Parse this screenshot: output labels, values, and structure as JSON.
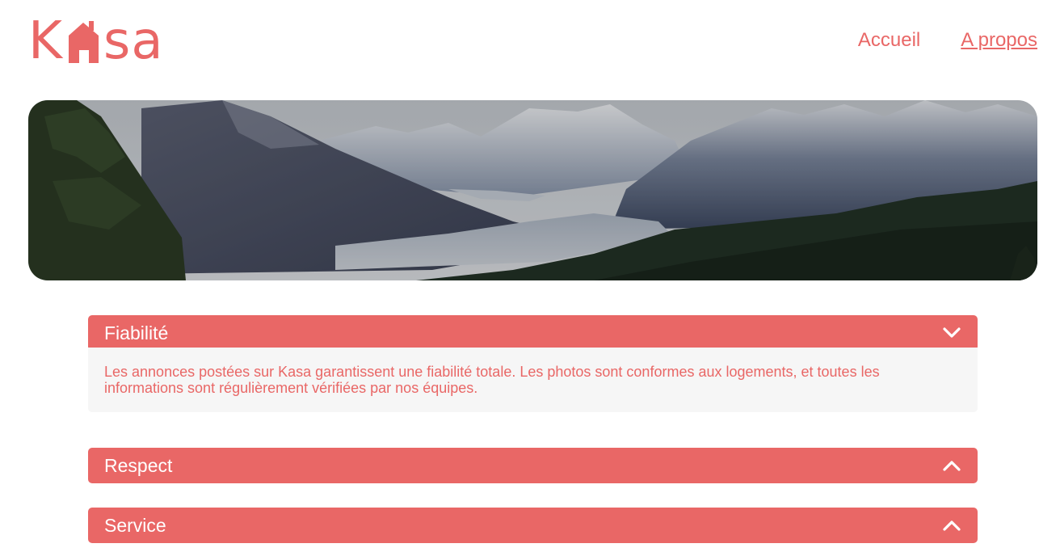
{
  "brand": {
    "name": "Kasa",
    "color": "#e96766",
    "logo_left": "K",
    "logo_right": "sa"
  },
  "nav": {
    "home_label": "Accueil",
    "about_label": "A propos",
    "active": "A propos"
  },
  "banner": {
    "image": "mountain-valley-landscape"
  },
  "accordions": [
    {
      "title": "Fiabilité",
      "expanded": true,
      "icon": "chevron-down-icon",
      "content": "Les annonces postées sur Kasa garantissent une fiabilité totale. Les photos sont conformes aux logements, et toutes les informations sont régulièrement vérifiées par nos équipes."
    },
    {
      "title": "Respect",
      "expanded": false,
      "icon": "chevron-up-icon"
    },
    {
      "title": "Service",
      "expanded": false,
      "icon": "chevron-up-icon"
    }
  ]
}
